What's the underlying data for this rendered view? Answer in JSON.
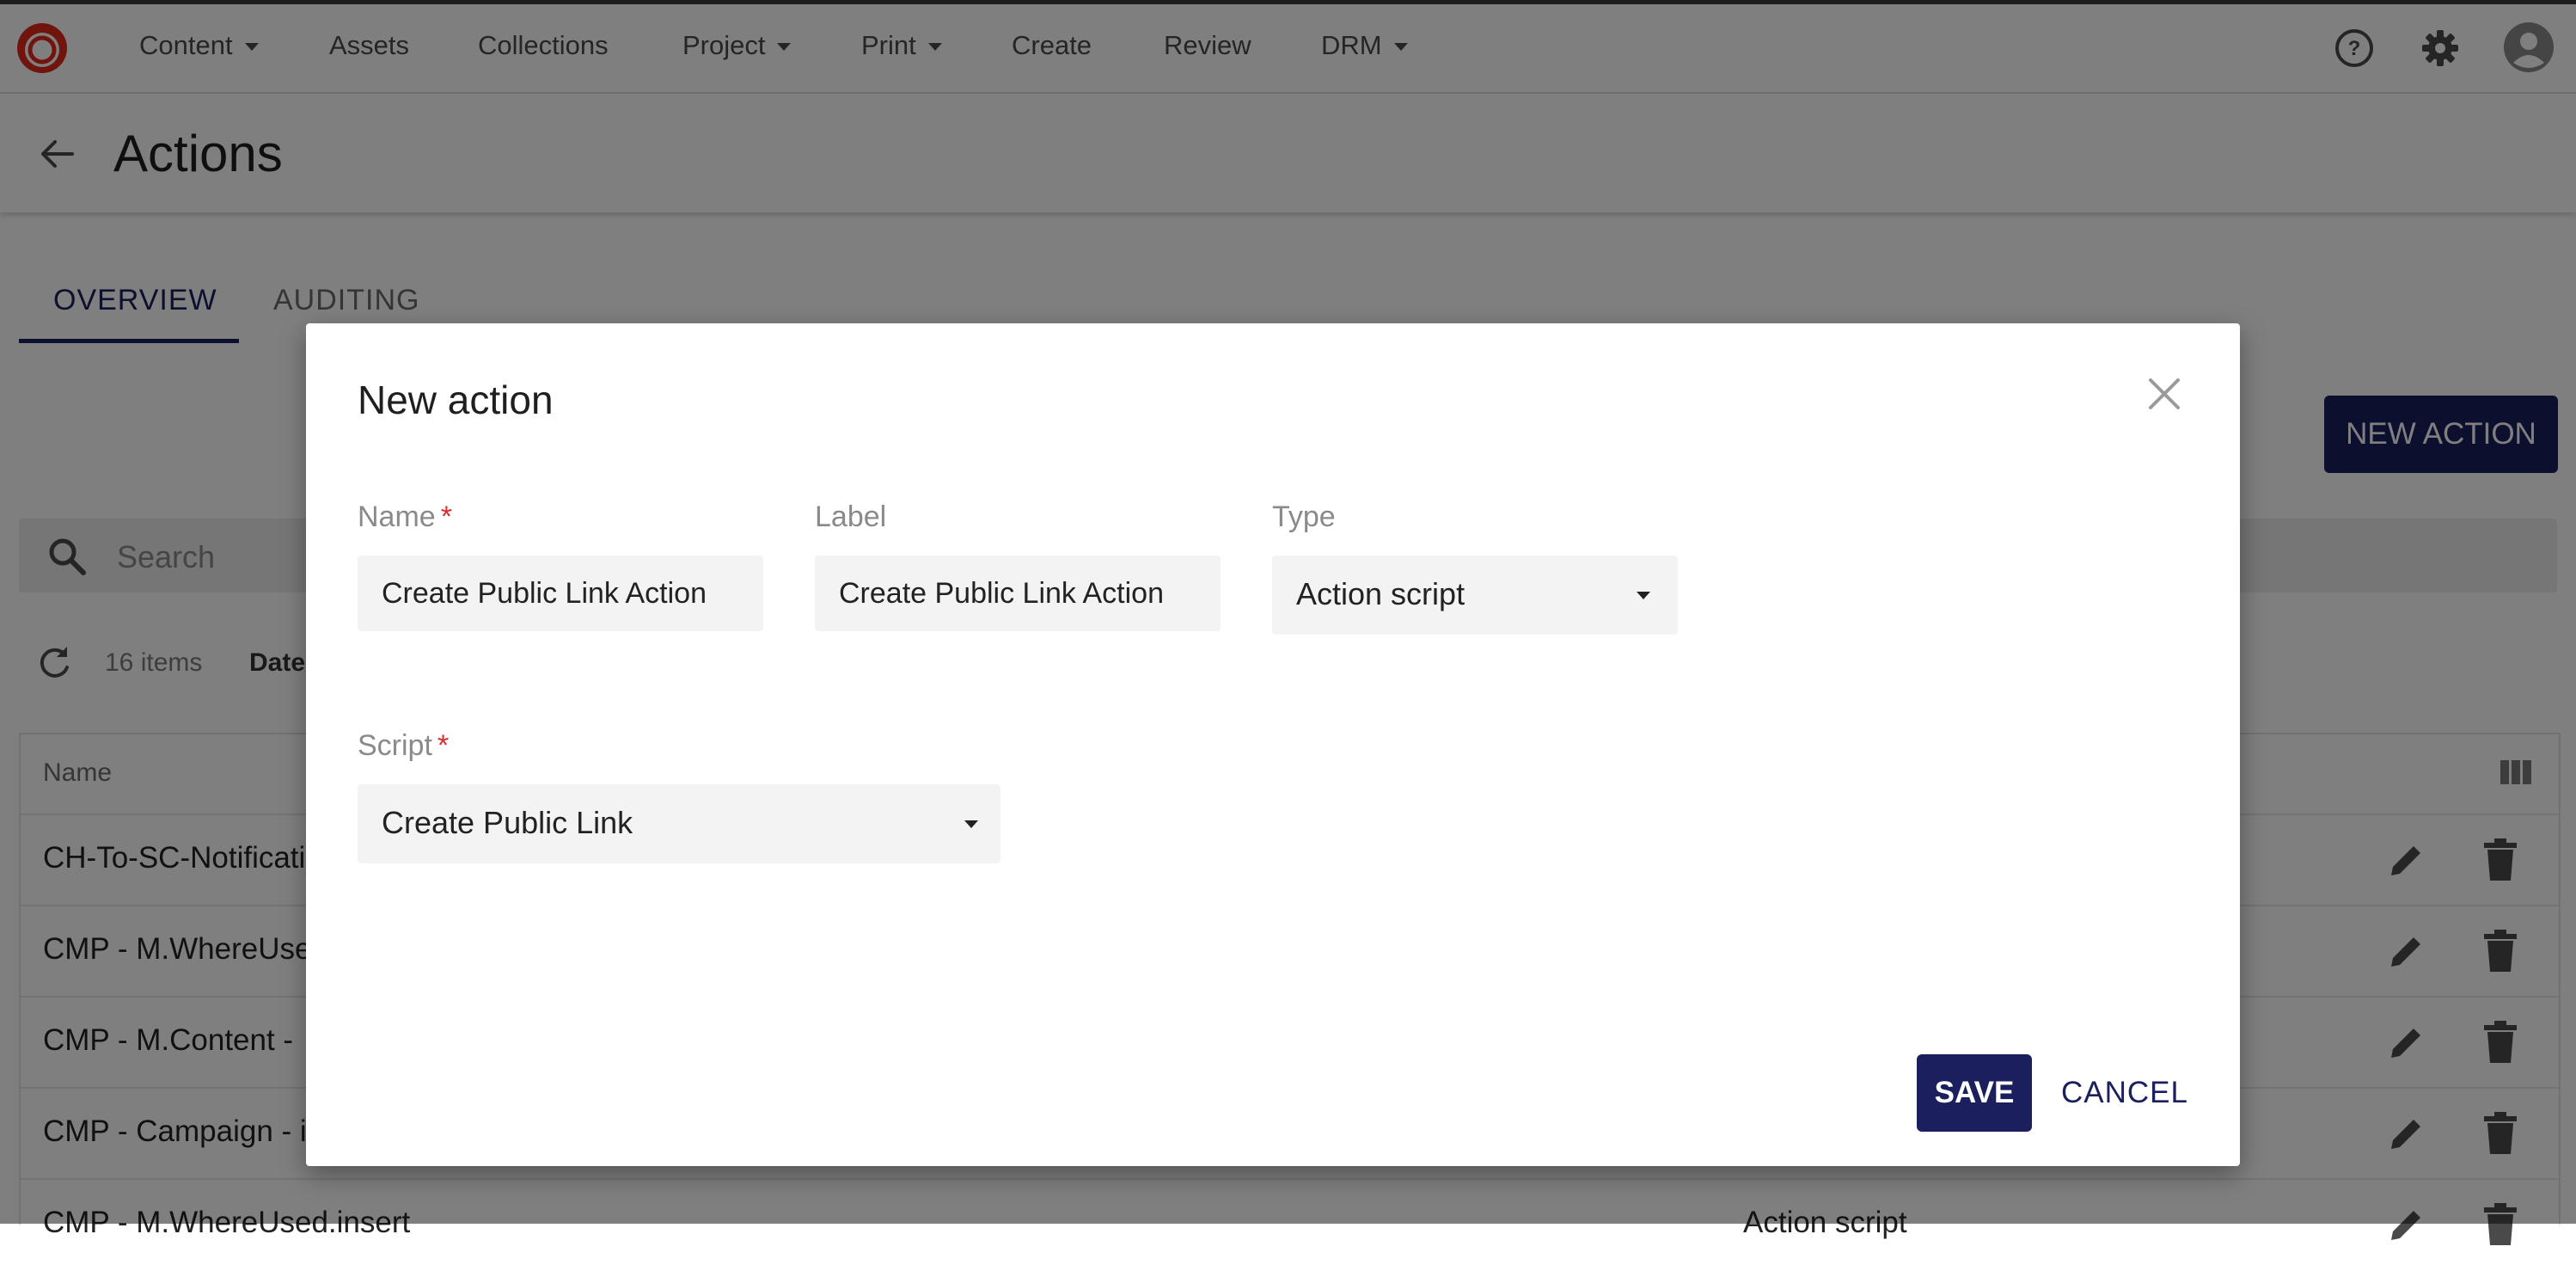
{
  "nav": {
    "items": [
      {
        "label": "Content",
        "dropdown": true
      },
      {
        "label": "Assets",
        "dropdown": false
      },
      {
        "label": "Collections",
        "dropdown": false
      },
      {
        "label": "Project",
        "dropdown": true
      },
      {
        "label": "Print",
        "dropdown": true
      },
      {
        "label": "Create",
        "dropdown": false
      },
      {
        "label": "Review",
        "dropdown": false
      },
      {
        "label": "DRM",
        "dropdown": true
      }
    ],
    "icons": [
      "help-icon",
      "gear-icon",
      "user-avatar-icon"
    ]
  },
  "page": {
    "title": "Actions",
    "tabs": [
      {
        "label": "OVERVIEW",
        "active": true
      },
      {
        "label": "AUDITING",
        "active": false
      }
    ],
    "new_action_label": "NEW ACTION",
    "search_placeholder": "Search",
    "items_count": "16 items",
    "date_label": "Date",
    "table": {
      "header_name": "Name",
      "rows": [
        {
          "name": "CH-To-SC-Notificati",
          "type": ""
        },
        {
          "name": "CMP - M.WhereUse",
          "type": ""
        },
        {
          "name": "CMP - M.Content - ",
          "type": ""
        },
        {
          "name": "CMP - Campaign - i",
          "type": ""
        },
        {
          "name": "CMP - M.WhereUsed.insert",
          "type": "Action script"
        }
      ]
    }
  },
  "dialog": {
    "title": "New action",
    "name_label": "Name",
    "name_value": "Create Public Link Action",
    "label_label": "Label",
    "label_value": "Create Public Link Action",
    "type_label": "Type",
    "type_value": "Action script",
    "script_label": "Script",
    "script_value": "Create Public Link",
    "required_mark": "*",
    "save_label": "SAVE",
    "cancel_label": "CANCEL"
  },
  "colors": {
    "primary": "#1b1f5e",
    "required": "#d32f2f",
    "logo": "#e0281b"
  }
}
